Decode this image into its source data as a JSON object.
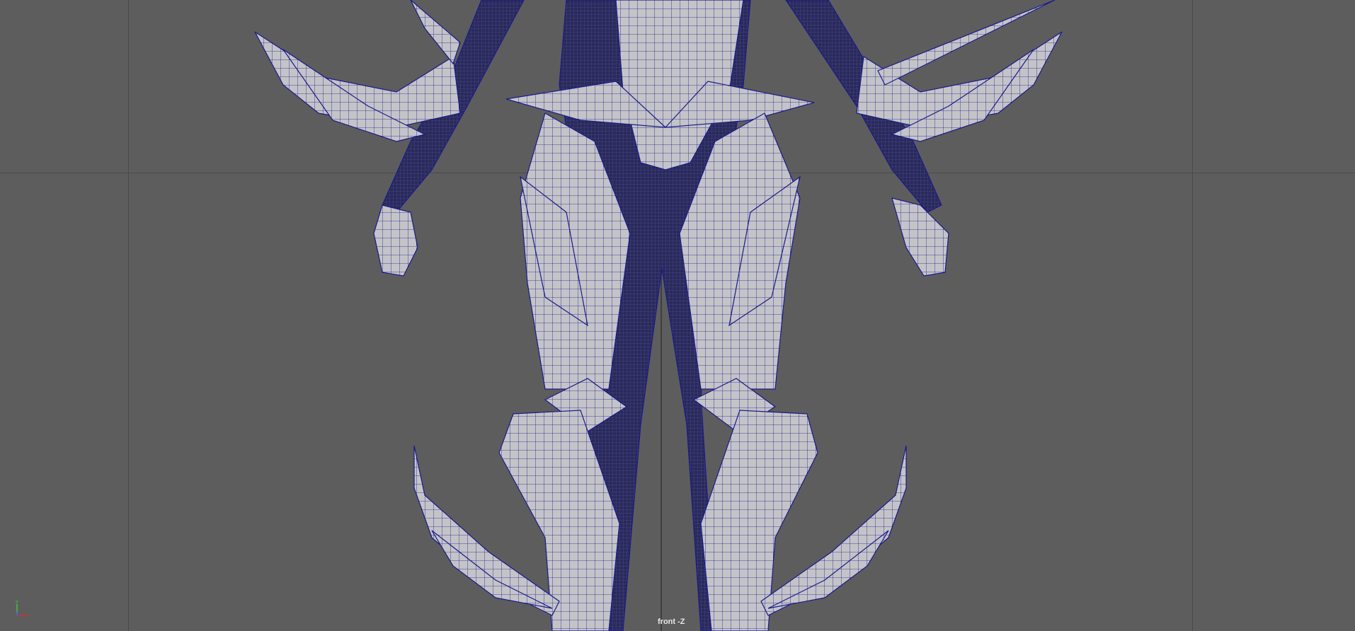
{
  "viewport": {
    "camera_label": "front -Z",
    "axis_labels": {
      "y": "y",
      "x": "x",
      "z": "z"
    },
    "colors": {
      "background": "#5d5d5d",
      "wireframe": "#1a1a8c",
      "surface": "#c4c4c8",
      "body": "#2a2a5a",
      "axis_x": "#d03030",
      "axis_y": "#40c040",
      "axis_z": "#4060e0"
    }
  }
}
